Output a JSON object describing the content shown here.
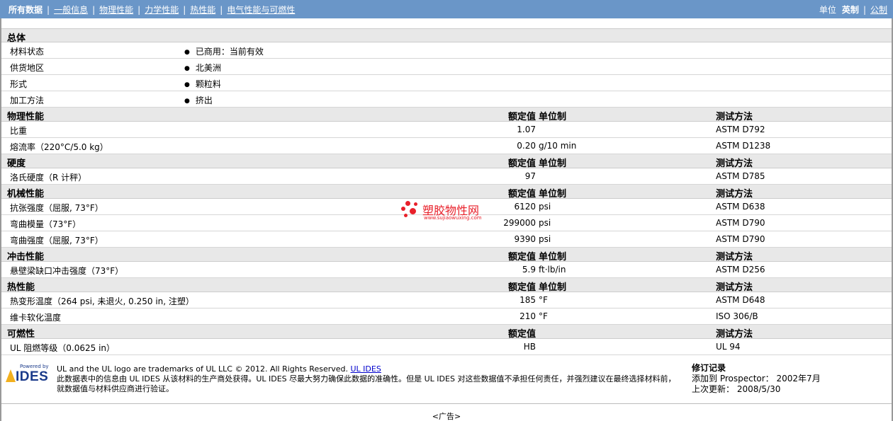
{
  "nav": {
    "tabs": [
      "所有数据",
      "一般信息",
      "物理性能",
      "力学性能",
      "热性能",
      "电气性能与可燃性"
    ],
    "units_label": "单位",
    "unit_english": "英制",
    "unit_metric": "公制"
  },
  "headers": {
    "rated": "额定值",
    "unit": "单位制",
    "method": "测试方法"
  },
  "general": {
    "title": "总体",
    "rows": [
      {
        "name": "材料状态",
        "value": "已商用：当前有效"
      },
      {
        "name": "供货地区",
        "value": "北美洲"
      },
      {
        "name": "形式",
        "value": "颗粒料"
      },
      {
        "name": "加工方法",
        "value": "挤出"
      }
    ]
  },
  "sections": [
    {
      "title": "物理性能",
      "rows": [
        {
          "name": "比重",
          "value": "1.07",
          "unit": "",
          "method": "ASTM D792"
        },
        {
          "name": "熔流率（220°C/5.0 kg）",
          "value": "0.20",
          "unit": "g/10 min",
          "method": "ASTM D1238"
        }
      ]
    },
    {
      "title": "硬度",
      "rows": [
        {
          "name": "洛氏硬度（R 计秤）",
          "value": "97",
          "unit": "",
          "method": "ASTM D785"
        }
      ]
    },
    {
      "title": "机械性能",
      "rows": [
        {
          "name": "抗张强度（屈服, 73°F）",
          "value": "6120",
          "unit": "psi",
          "method": "ASTM D638"
        },
        {
          "name": "弯曲模量（73°F）",
          "value": "299000",
          "unit": "psi",
          "method": "ASTM D790"
        },
        {
          "name": "弯曲强度（屈服, 73°F）",
          "value": "9390",
          "unit": "psi",
          "method": "ASTM D790"
        }
      ]
    },
    {
      "title": "冲击性能",
      "rows": [
        {
          "name": "悬壁梁缺口冲击强度（73°F）",
          "value": "5.9",
          "unit": "ft·lb/in",
          "method": "ASTM D256"
        }
      ]
    },
    {
      "title": "热性能",
      "rows": [
        {
          "name": "热变形温度（264 psi, 未退火, 0.250 in, 注塑）",
          "value": "185",
          "unit": "°F",
          "method": "ASTM D648"
        },
        {
          "name": "维卡软化温度",
          "value": "210",
          "unit": "°F",
          "method": "ISO 306/B"
        }
      ]
    },
    {
      "title": "可燃性",
      "no_unit_header": true,
      "rows": [
        {
          "name": "UL 阻燃等级（0.0625 in）",
          "value": "HB",
          "unit": "",
          "method": "UL 94"
        }
      ]
    }
  ],
  "watermark": {
    "title": "塑胶物性网",
    "url": "www.sujiaowuxing.com",
    "color": "#e8202a"
  },
  "footer": {
    "logo_powered": "Powered by",
    "logo_ides": "IDES",
    "trademark": "UL and the UL logo are trademarks of UL LLC © 2012. All Rights Reserved.",
    "ul_ides_link": "UL IDES",
    "disclaimer": "此数据表中的信息由 UL IDES 从该材料的生产商处获得。UL IDES 尽最大努力确保此数据的准确性。但是 UL IDES 对这些数据值不承担任何责任，并强烈建议在最终选择材料前，就数据值与材料供应商进行验证。",
    "revision_title": "修订记录",
    "added_label": "添加到 Prospector：",
    "added_value": "2002年7月",
    "updated_label": "上次更新：",
    "updated_value": "2008/5/30",
    "ad": "<广告>"
  },
  "colors": {
    "nav_bg": "#6a96c8",
    "section_bg": "#e8e8e8",
    "link": "#0000cc"
  }
}
